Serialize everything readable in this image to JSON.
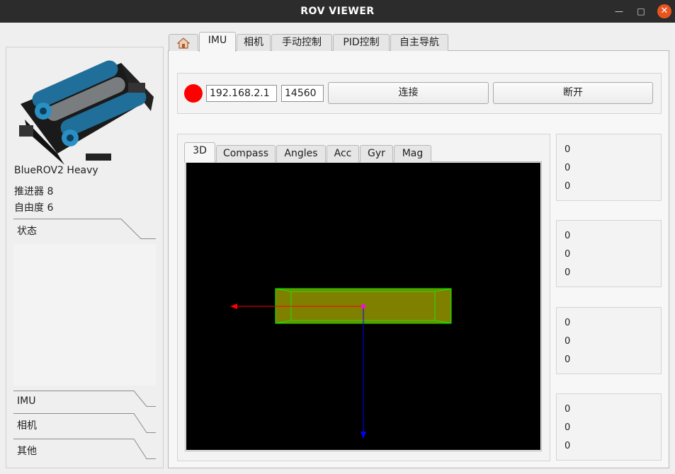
{
  "window": {
    "title": "ROV VIEWER"
  },
  "rov": {
    "name": "BlueROV2 Heavy",
    "thrusters": "推进器 8",
    "dof": "自由度 6"
  },
  "toolbox": {
    "status": "状态",
    "imu": "IMU",
    "camera": "相机",
    "other": "其他"
  },
  "main_tabs": {
    "home_icon": "home-icon",
    "imu": "IMU",
    "camera": "相机",
    "manual": "手动控制",
    "pid": "PID控制",
    "nav": "自主导航"
  },
  "connection": {
    "indicator_color": "#ff0000",
    "ip": "192.168.2.1",
    "port": "14560",
    "connect": "连接",
    "disconnect": "断开"
  },
  "imu_tabs": {
    "t3d": "3D",
    "compass": "Compass",
    "angles": "Angles",
    "acc": "Acc",
    "gyr": "Gyr",
    "mag": "Mag"
  },
  "readouts": [
    [
      "0",
      "0",
      "0"
    ],
    [
      "0",
      "0",
      "0"
    ],
    [
      "0",
      "0",
      "0"
    ],
    [
      "0",
      "0",
      "0"
    ]
  ],
  "colors": {
    "model_fill": "#808000",
    "model_edge": "#00ff00",
    "x_axis": "#ff0000",
    "z_axis": "#0000ff",
    "origin": "#ff00ff"
  }
}
